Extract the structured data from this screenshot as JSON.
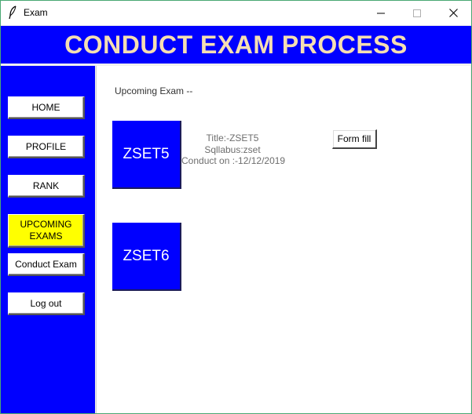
{
  "window": {
    "title": "Exam",
    "icon": "feather-icon",
    "controls": [
      "minimize-icon",
      "maximize-icon",
      "close-icon"
    ]
  },
  "header": {
    "title": "CONDUCT EXAM PROCESS",
    "background": "#0000ff",
    "color": "#f5deb3"
  },
  "sidebar": {
    "background": "#0000ff",
    "items": [
      {
        "label": "HOME"
      },
      {
        "label": "PROFILE"
      },
      {
        "label": "RANK"
      },
      {
        "label": "UPCOMING\nEXAMS",
        "active": true,
        "highlight": "#ffff00"
      },
      {
        "label": "Conduct Exam"
      },
      {
        "label": "Log out"
      }
    ]
  },
  "main": {
    "section_label": "Upcoming Exam --",
    "exams": [
      {
        "tile_label": "ZSET5",
        "details": {
          "title": "Title:-ZSET5",
          "syllabus": "Sqllabus:zset",
          "conduct_on": "Conduct on :-12/12/2019"
        },
        "action_label": "Form fill"
      },
      {
        "tile_label": "ZSET6"
      }
    ]
  }
}
